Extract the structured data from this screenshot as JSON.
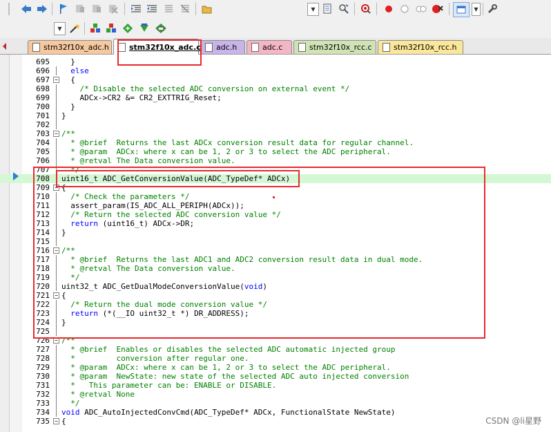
{
  "tabs": [
    {
      "label": "stm32f10x_adc.h",
      "color": "#f6c89f"
    },
    {
      "label": "stm32f10x_adc.c",
      "color": "#ffffff",
      "active": true
    },
    {
      "label": "adc.h",
      "color": "#c8b4e8"
    },
    {
      "label": "adc.c",
      "color": "#f4b6c4"
    },
    {
      "label": "stm32f10x_rcc.c",
      "color": "#cfe3b4"
    },
    {
      "label": "stm32f10x_rcc.h",
      "color": "#fbe79a"
    }
  ],
  "toolbar1": {
    "icons": [
      "back-icon",
      "forward-icon",
      "bookmark-flag-icon",
      "prev-bookmark-icon",
      "next-bookmark-icon",
      "clear-bookmarks-icon",
      "indent-icon",
      "unindent-icon",
      "comment-icon",
      "uncomment-icon",
      "open-file-icon",
      "find-in-files-icon",
      "find-replace-icon",
      "debug-start-icon",
      "breakpoint-icon",
      "disable-breakpoint-icon",
      "kill-breakpoints-icon",
      "breakpoint-window-icon",
      "view-window-icon",
      "configure-icon"
    ]
  },
  "toolbar2": {
    "icons": [
      "magic-wand-icon",
      "build-target-icon",
      "translate-icon",
      "rebuild-icon",
      "download-icon",
      "pack-installer-icon"
    ]
  },
  "editor": {
    "lines": [
      {
        "n": "695",
        "fold": "",
        "segs": [
          {
            "t": "  }",
            "c": ""
          }
        ]
      },
      {
        "n": "696",
        "fold": "",
        "segs": [
          {
            "t": "  ",
            "c": ""
          },
          {
            "t": "else",
            "c": "kw"
          }
        ]
      },
      {
        "n": "697",
        "fold": "-",
        "segs": [
          {
            "t": "  {",
            "c": ""
          }
        ]
      },
      {
        "n": "698",
        "fold": "",
        "segs": [
          {
            "t": "    ",
            "c": ""
          },
          {
            "t": "/* Disable the selected ADC conversion on external event */",
            "c": "cm"
          }
        ]
      },
      {
        "n": "699",
        "fold": "",
        "segs": [
          {
            "t": "    ADCx->CR2 &= CR2_EXTTRIG_Reset;",
            "c": ""
          }
        ]
      },
      {
        "n": "700",
        "fold": "",
        "segs": [
          {
            "t": "  }",
            "c": ""
          }
        ]
      },
      {
        "n": "701",
        "fold": "",
        "segs": [
          {
            "t": "}",
            "c": ""
          }
        ]
      },
      {
        "n": "702",
        "fold": "",
        "segs": []
      },
      {
        "n": "703",
        "fold": "-",
        "segs": [
          {
            "t": "/**",
            "c": "cm"
          }
        ]
      },
      {
        "n": "704",
        "fold": "",
        "segs": [
          {
            "t": "  * @brief  Returns the last ADCx conversion result data for regular channel.",
            "c": "cm"
          }
        ]
      },
      {
        "n": "705",
        "fold": "",
        "segs": [
          {
            "t": "  * @param  ADCx: where x can be 1, 2 or 3 to select the ADC peripheral.",
            "c": "cm"
          }
        ]
      },
      {
        "n": "706",
        "fold": "",
        "segs": [
          {
            "t": "  * @retval The Data conversion value.",
            "c": "cm"
          }
        ]
      },
      {
        "n": "707",
        "fold": "",
        "segs": [
          {
            "t": "  */",
            "c": "cm"
          }
        ]
      },
      {
        "n": "708",
        "fold": "",
        "hl": true,
        "segs": [
          {
            "t": "uint16_t ADC_GetConversionValue(ADC_TypeDef* ADCx)",
            "c": ""
          }
        ]
      },
      {
        "n": "709",
        "fold": "-",
        "segs": [
          {
            "t": "{",
            "c": ""
          }
        ]
      },
      {
        "n": "710",
        "fold": "",
        "segs": [
          {
            "t": "  ",
            "c": ""
          },
          {
            "t": "/* Check the parameters */",
            "c": "cm"
          }
        ]
      },
      {
        "n": "711",
        "fold": "",
        "segs": [
          {
            "t": "  assert_param(IS_ADC_ALL_PERIPH(ADCx));",
            "c": ""
          }
        ]
      },
      {
        "n": "712",
        "fold": "",
        "segs": [
          {
            "t": "  ",
            "c": ""
          },
          {
            "t": "/* Return the selected ADC conversion value */",
            "c": "cm"
          }
        ]
      },
      {
        "n": "713",
        "fold": "",
        "segs": [
          {
            "t": "  ",
            "c": ""
          },
          {
            "t": "return",
            "c": "kw"
          },
          {
            "t": " (uint16_t) ADCx->DR;",
            "c": ""
          }
        ]
      },
      {
        "n": "714",
        "fold": "",
        "segs": [
          {
            "t": "}",
            "c": ""
          }
        ]
      },
      {
        "n": "715",
        "fold": "",
        "segs": []
      },
      {
        "n": "716",
        "fold": "-",
        "segs": [
          {
            "t": "/**",
            "c": "cm"
          }
        ]
      },
      {
        "n": "717",
        "fold": "",
        "segs": [
          {
            "t": "  * @brief  Returns the last ADC1 and ADC2 conversion result data in dual mode.",
            "c": "cm"
          }
        ]
      },
      {
        "n": "718",
        "fold": "",
        "segs": [
          {
            "t": "  * @retval The Data conversion value.",
            "c": "cm"
          }
        ]
      },
      {
        "n": "719",
        "fold": "",
        "segs": [
          {
            "t": "  */",
            "c": "cm"
          }
        ]
      },
      {
        "n": "720",
        "fold": "",
        "segs": [
          {
            "t": "uint32_t ADC_GetDualModeConversionValue(",
            "c": ""
          },
          {
            "t": "void",
            "c": "kw"
          },
          {
            "t": ")",
            "c": ""
          }
        ]
      },
      {
        "n": "721",
        "fold": "-",
        "segs": [
          {
            "t": "{",
            "c": ""
          }
        ]
      },
      {
        "n": "722",
        "fold": "",
        "segs": [
          {
            "t": "  ",
            "c": ""
          },
          {
            "t": "/* Return the dual mode conversion value */",
            "c": "cm"
          }
        ]
      },
      {
        "n": "723",
        "fold": "",
        "segs": [
          {
            "t": "  ",
            "c": ""
          },
          {
            "t": "return",
            "c": "kw"
          },
          {
            "t": " (*(__IO uint32_t *) DR_ADDRESS);",
            "c": ""
          }
        ]
      },
      {
        "n": "724",
        "fold": "",
        "segs": [
          {
            "t": "}",
            "c": ""
          }
        ]
      },
      {
        "n": "725",
        "fold": "",
        "segs": []
      },
      {
        "n": "726",
        "fold": "-",
        "segs": [
          {
            "t": "/**",
            "c": "cm"
          }
        ]
      },
      {
        "n": "727",
        "fold": "",
        "segs": [
          {
            "t": "  * @brief  Enables or disables the selected ADC automatic injected group",
            "c": "cm"
          }
        ]
      },
      {
        "n": "728",
        "fold": "",
        "segs": [
          {
            "t": "  *         conversion after regular one.",
            "c": "cm"
          }
        ]
      },
      {
        "n": "729",
        "fold": "",
        "segs": [
          {
            "t": "  * @param  ADCx: where x can be 1, 2 or 3 to select the ADC peripheral.",
            "c": "cm"
          }
        ]
      },
      {
        "n": "730",
        "fold": "",
        "segs": [
          {
            "t": "  * @param  NewState: new state of the selected ADC auto injected conversion",
            "c": "cm"
          }
        ]
      },
      {
        "n": "731",
        "fold": "",
        "segs": [
          {
            "t": "  *   This parameter can be: ENABLE or DISABLE.",
            "c": "cm"
          }
        ]
      },
      {
        "n": "732",
        "fold": "",
        "segs": [
          {
            "t": "  * @retval None",
            "c": "cm"
          }
        ]
      },
      {
        "n": "733",
        "fold": "",
        "segs": [
          {
            "t": "  */",
            "c": "cm"
          }
        ]
      },
      {
        "n": "734",
        "fold": "",
        "segs": [
          {
            "t": "void",
            "c": "kw"
          },
          {
            "t": " ADC_AutoInjectedConvCmd(ADC_TypeDef* ADCx, FunctionalState NewState)",
            "c": ""
          }
        ]
      },
      {
        "n": "735",
        "fold": "-",
        "segs": [
          {
            "t": "{",
            "c": ""
          }
        ]
      }
    ]
  },
  "watermark": "CSDN @li星野"
}
